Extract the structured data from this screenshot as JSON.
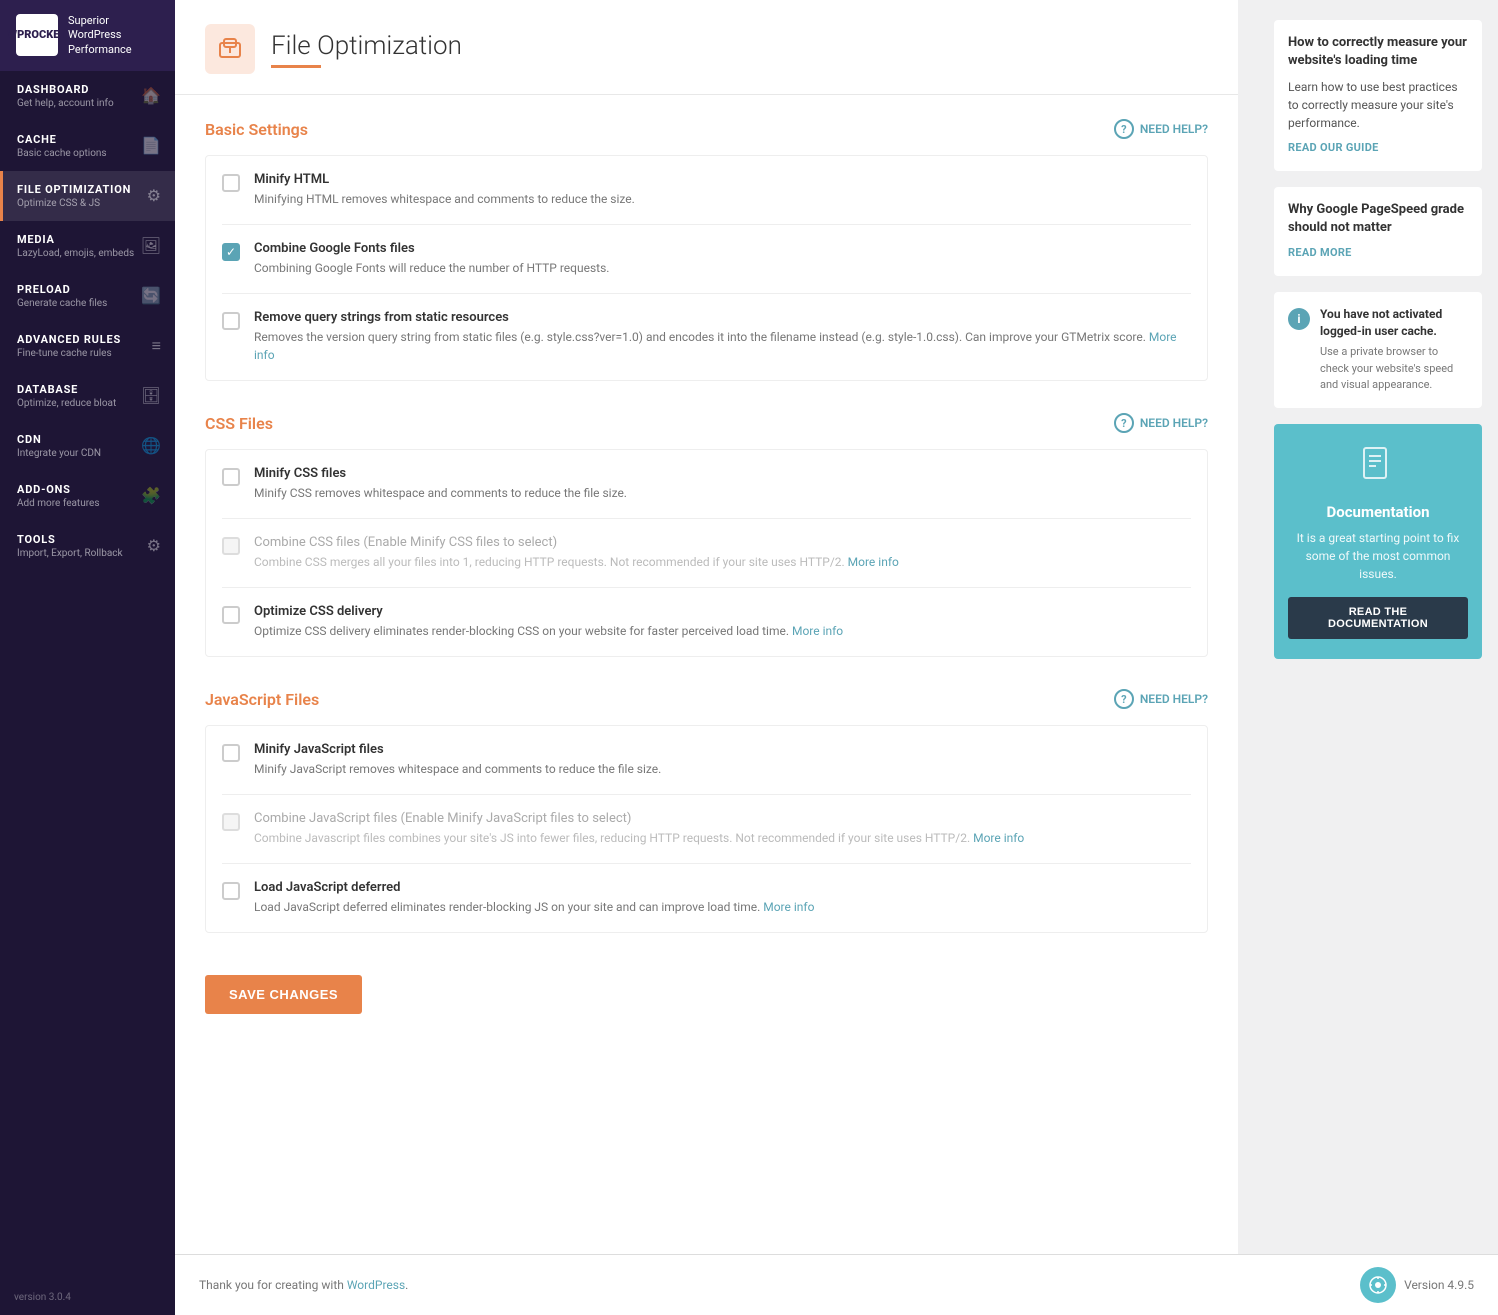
{
  "sidebar": {
    "logo": {
      "text_line1": "WP",
      "text_line2": "ROCKET",
      "subtitle": "Superior WordPress Performance"
    },
    "nav": [
      {
        "id": "dashboard",
        "title": "DASHBOARD",
        "subtitle": "Get help, account info",
        "icon": "🏠",
        "active": false
      },
      {
        "id": "cache",
        "title": "CACHE",
        "subtitle": "Basic cache options",
        "icon": "📄",
        "active": false
      },
      {
        "id": "file-optimization",
        "title": "FILE OPTIMIZATION",
        "subtitle": "Optimize CSS & JS",
        "icon": "⚙",
        "active": true
      },
      {
        "id": "media",
        "title": "MEDIA",
        "subtitle": "LazyLoad, emojis, embeds",
        "icon": "🖼",
        "active": false
      },
      {
        "id": "preload",
        "title": "PRELOAD",
        "subtitle": "Generate cache files",
        "icon": "🔄",
        "active": false
      },
      {
        "id": "advanced-rules",
        "title": "ADVANCED RULES",
        "subtitle": "Fine-tune cache rules",
        "icon": "≡",
        "active": false
      },
      {
        "id": "database",
        "title": "DATABASE",
        "subtitle": "Optimize, reduce bloat",
        "icon": "🗄",
        "active": false
      },
      {
        "id": "cdn",
        "title": "CDN",
        "subtitle": "Integrate your CDN",
        "icon": "🌐",
        "active": false
      },
      {
        "id": "add-ons",
        "title": "ADD-ONS",
        "subtitle": "Add more features",
        "icon": "🧩",
        "active": false
      },
      {
        "id": "tools",
        "title": "TOOLS",
        "subtitle": "Import, Export, Rollback",
        "icon": "⚙",
        "active": false
      }
    ],
    "version": "version 3.0.4"
  },
  "page": {
    "icon": "⬡",
    "title": "File Optimization",
    "sections": [
      {
        "id": "basic-settings",
        "title": "Basic Settings",
        "need_help_label": "NEED HELP?",
        "options": [
          {
            "id": "minify-html",
            "label": "Minify HTML",
            "desc": "Minifying HTML removes whitespace and comments to reduce the size.",
            "checked": false,
            "disabled": false
          },
          {
            "id": "combine-google-fonts",
            "label": "Combine Google Fonts files",
            "desc": "Combining Google Fonts will reduce the number of HTTP requests.",
            "checked": true,
            "disabled": false
          },
          {
            "id": "remove-query-strings",
            "label": "Remove query strings from static resources",
            "desc": "Removes the version query string from static files (e.g. style.css?ver=1.0) and encodes it into the filename instead (e.g. style-1.0.css). Can improve your GTMetrix score.",
            "desc_link": "More info",
            "desc_link_href": "#",
            "checked": false,
            "disabled": false
          }
        ]
      },
      {
        "id": "css-files",
        "title": "CSS Files",
        "need_help_label": "NEED HELP?",
        "options": [
          {
            "id": "minify-css",
            "label": "Minify CSS files",
            "desc": "Minify CSS removes whitespace and comments to reduce the file size.",
            "checked": false,
            "disabled": false
          },
          {
            "id": "combine-css",
            "label": "Combine CSS files",
            "label_note": "(Enable Minify CSS files to select)",
            "desc": "Combine CSS merges all your files into 1, reducing HTTP requests. Not recommended if your site uses HTTP/2.",
            "desc_link": "More info",
            "desc_link_href": "#",
            "checked": false,
            "disabled": true
          },
          {
            "id": "optimize-css-delivery",
            "label": "Optimize CSS delivery",
            "desc": "Optimize CSS delivery eliminates render-blocking CSS on your website for faster perceived load time.",
            "desc_link": "More info",
            "desc_link_href": "#",
            "checked": false,
            "disabled": false
          }
        ]
      },
      {
        "id": "js-files",
        "title": "JavaScript Files",
        "need_help_label": "NEED HELP?",
        "options": [
          {
            "id": "minify-js",
            "label": "Minify JavaScript files",
            "desc": "Minify JavaScript removes whitespace and comments to reduce the file size.",
            "checked": false,
            "disabled": false
          },
          {
            "id": "combine-js",
            "label": "Combine JavaScript files",
            "label_note": "(Enable Minify JavaScript files to select)",
            "desc": "Combine Javascript files combines your site's JS into fewer files, reducing HTTP requests. Not recommended if your site uses HTTP/2.",
            "desc_link": "More info",
            "desc_link_href": "#",
            "checked": false,
            "disabled": true
          },
          {
            "id": "defer-js",
            "label": "Load JavaScript deferred",
            "desc": "Load JavaScript deferred eliminates render-blocking JS on your site and can improve load time.",
            "desc_link": "More info",
            "desc_link_href": "#",
            "checked": false,
            "disabled": false
          }
        ]
      }
    ],
    "save_button": "SAVE CHANGES"
  },
  "right_sidebar": {
    "header_title": "How to correctly measure your website's loading time",
    "tip1": {
      "desc": "Learn how to use best practices to correctly measure your site's performance.",
      "link": "READ OUR GUIDE"
    },
    "tip2": {
      "title": "Why Google PageSpeed grade should not matter",
      "link": "READ MORE"
    },
    "warning": {
      "icon": "i",
      "title": "You have not activated logged-in user cache.",
      "desc": "Use a private browser to check your website's speed and visual appearance."
    },
    "doc_card": {
      "title": "Documentation",
      "desc": "It is a great starting point to fix some of the most common issues.",
      "button": "READ THE DOCUMENTATION"
    }
  },
  "footer": {
    "text": "Thank you for creating with",
    "link_label": "WordPress",
    "version_label": "Version 4.9.5"
  }
}
